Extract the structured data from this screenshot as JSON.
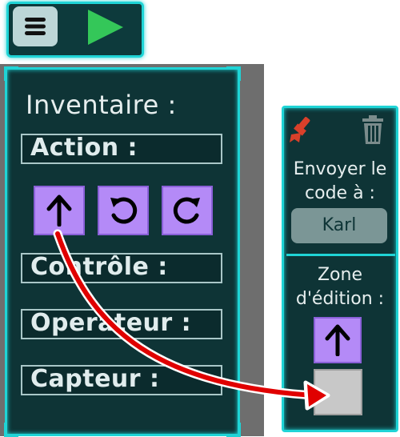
{
  "inventory": {
    "title": "Inventaire :",
    "sections": {
      "action": "Action :",
      "controle": "Contrôle :",
      "operateur": "Operateur :",
      "capteur": "Capteur :"
    },
    "action_blocks": [
      "arrow-up-icon",
      "rotate-left-icon",
      "rotate-right-icon"
    ]
  },
  "right_panel": {
    "send_code_line1": "Envoyer le",
    "send_code_line2": "code à :",
    "recipient": "Karl",
    "edit_zone_line1": "Zone",
    "edit_zone_line2": "d'édition :"
  },
  "colors": {
    "panel_bg": "#0e3436",
    "accent_cyan": "#1fd4d6",
    "block_purple": "#b48af7",
    "play_green": "#34c759",
    "arrow_red": "#e00000"
  }
}
